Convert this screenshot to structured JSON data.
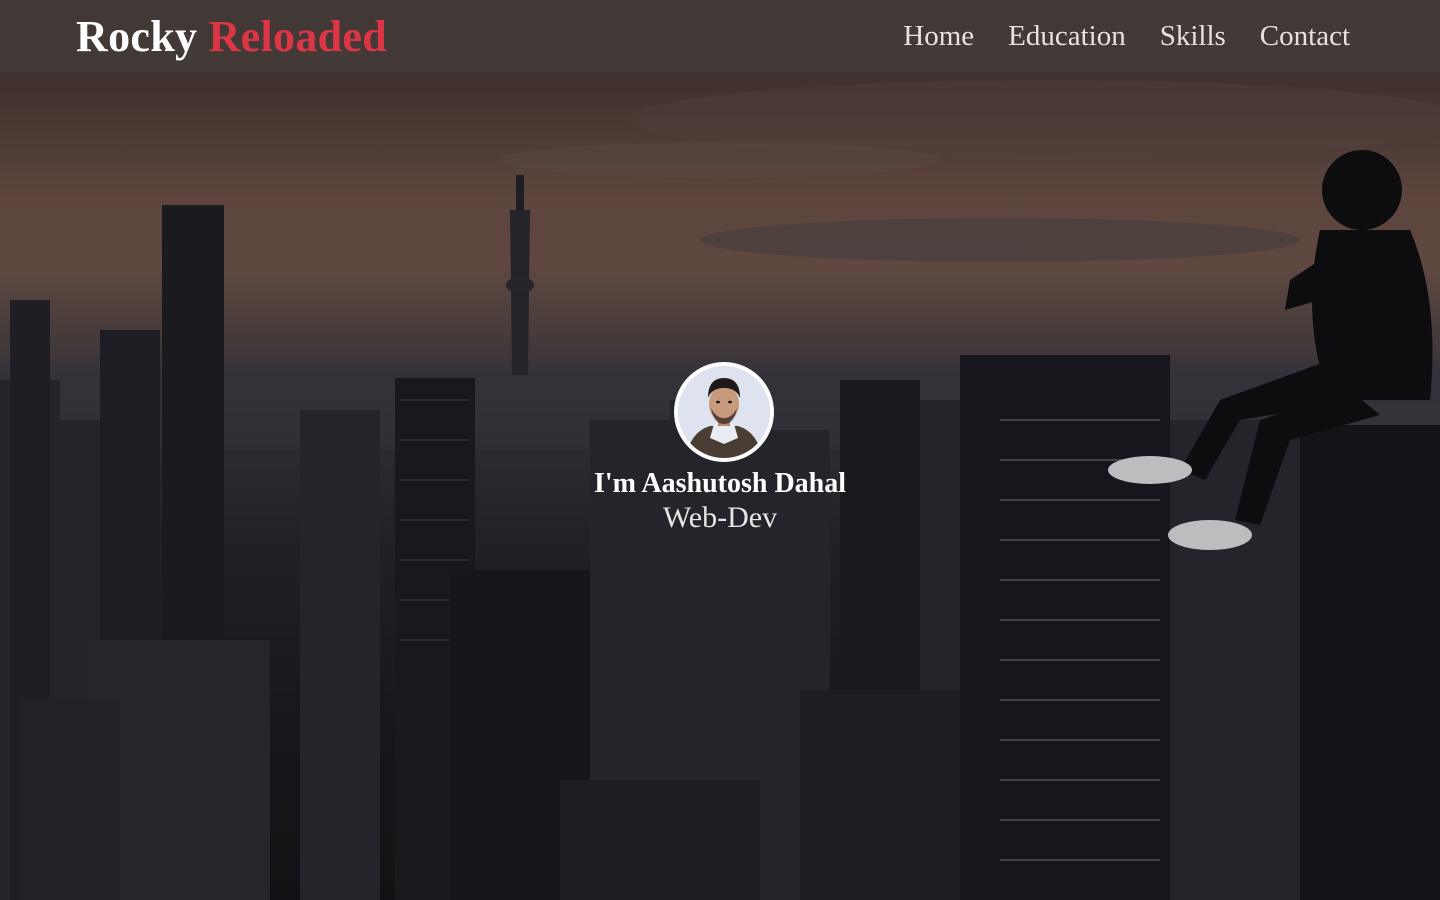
{
  "brand": {
    "first": "Rocky",
    "second": "Reloaded",
    "accent_color": "#dc3545"
  },
  "nav": {
    "home": "Home",
    "education": "Education",
    "skills": "Skills",
    "contact": "Contact"
  },
  "hero": {
    "name": "I'm Aashutosh Dahal",
    "role": "Web-Dev"
  }
}
